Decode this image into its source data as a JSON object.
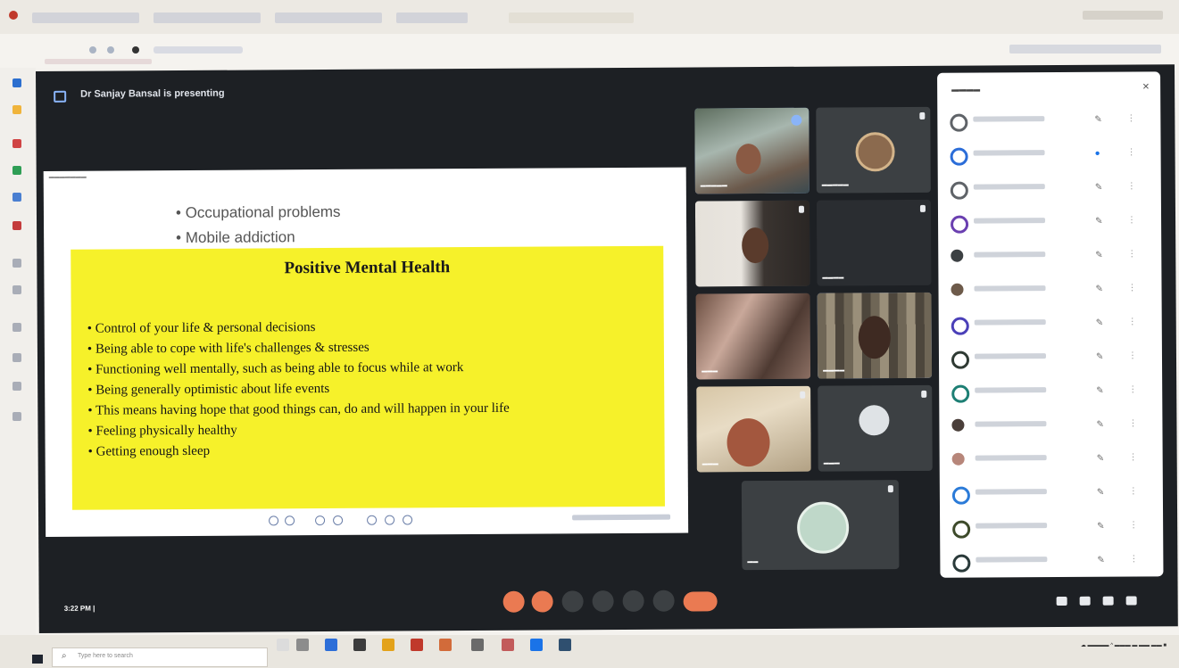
{
  "meet": {
    "presenter_banner": "Dr Sanjay Bansal is presenting",
    "clock": "3:22 PM  |  ",
    "end_call_label": ""
  },
  "slide": {
    "partial_bullets": [
      "Occupational problems",
      "Mobile addiction"
    ],
    "box_title": "Positive Mental Health",
    "box_bullets": [
      "Control of your life & personal decisions",
      "Being able to cope with life's challenges & stresses",
      "Functioning well mentally, such as being able to focus while at work",
      "Being generally optimistic about life events",
      "This means having hope that good things can, do and will happen in your life",
      "Feeling physically healthy",
      "Getting enough sleep"
    ]
  },
  "panel": {
    "close_icon": "close-icon"
  },
  "taskbar": {
    "search_placeholder": "Type here to search"
  },
  "colors": {
    "highlight": "#f6f12a",
    "meet_bg": "#1d2024",
    "end_call": "#ea7a52",
    "panel_bg": "#ffffff"
  }
}
